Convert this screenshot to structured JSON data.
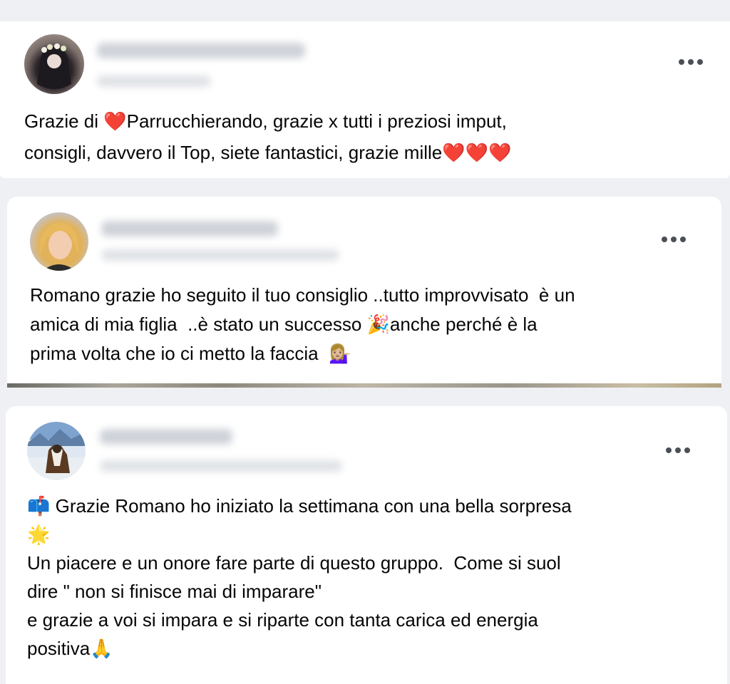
{
  "posts": [
    {
      "text": "Grazie di ❤️Parrucchierando, grazie x tutti i preziosi imput,\nconsigli, davvero il Top, siete fantastici, grazie mille❤️❤️❤️"
    },
    {
      "text": "Romano grazie ho seguito il tuo consiglio ..tutto improvvisato  è un\namica di mia figlia  ..è stato un successo 🎉anche perché è la\nprima volta che io ci metto la faccia  💁🏼‍♀️"
    },
    {
      "text": "📫 Grazie Romano ho iniziato la settimana con una bella sorpresa\n🌟\nUn piacere e un onore fare parte di questo gruppo.  Come si suol\ndire \" non si finisce mai di imparare\"\ne grazie a voi si impara e si riparte con tanta carica ed energia\npositiva🙏"
    }
  ],
  "colors": {
    "background": "#eef0f3",
    "card": "#ffffff",
    "text": "#050505",
    "more_icon": "#4b4f56"
  },
  "icons": {
    "more_options": "three-dots-horizontal"
  }
}
